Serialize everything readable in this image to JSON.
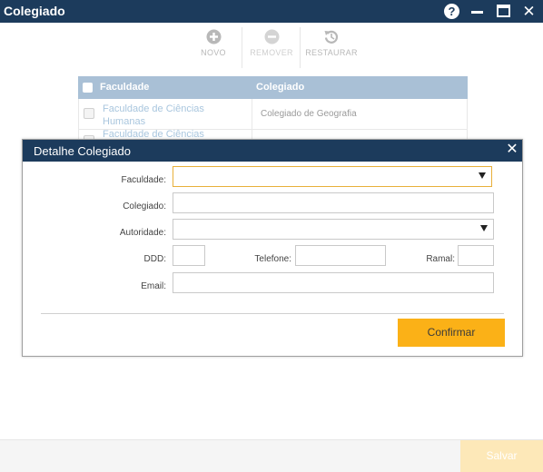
{
  "window": {
    "title": "Colegiado",
    "help_glyph": "?"
  },
  "toolbar": {
    "novo": "NOVO",
    "remover": "REMOVER",
    "restaurar": "RESTAURAR"
  },
  "grid": {
    "headers": [
      "Faculdade",
      "Colegiado"
    ],
    "rows": [
      {
        "faculdade": "Faculdade de Ciências Humanas",
        "colegiado": "Colegiado de Geografia"
      },
      {
        "faculdade": "Faculdade de Ciências",
        "colegiado": ""
      }
    ]
  },
  "footer": {
    "salvar": "Salvar"
  },
  "modal": {
    "title": "Detalhe Colegiado",
    "close_glyph": "✕",
    "labels": {
      "faculdade": "Faculdade:",
      "colegiado": "Colegiado:",
      "autoridade": "Autoridade:",
      "ddd": "DDD:",
      "telefone": "Telefone:",
      "ramal": "Ramal:",
      "email": "Email:"
    },
    "values": {
      "faculdade": "",
      "colegiado": "",
      "autoridade": "",
      "ddd": "",
      "telefone": "",
      "ramal": "",
      "email": ""
    },
    "confirm": "Confirmar"
  },
  "colors": {
    "header_bg": "#1c3b5c",
    "accent": "#fbb117",
    "grid_header": "#a9c0d6"
  }
}
